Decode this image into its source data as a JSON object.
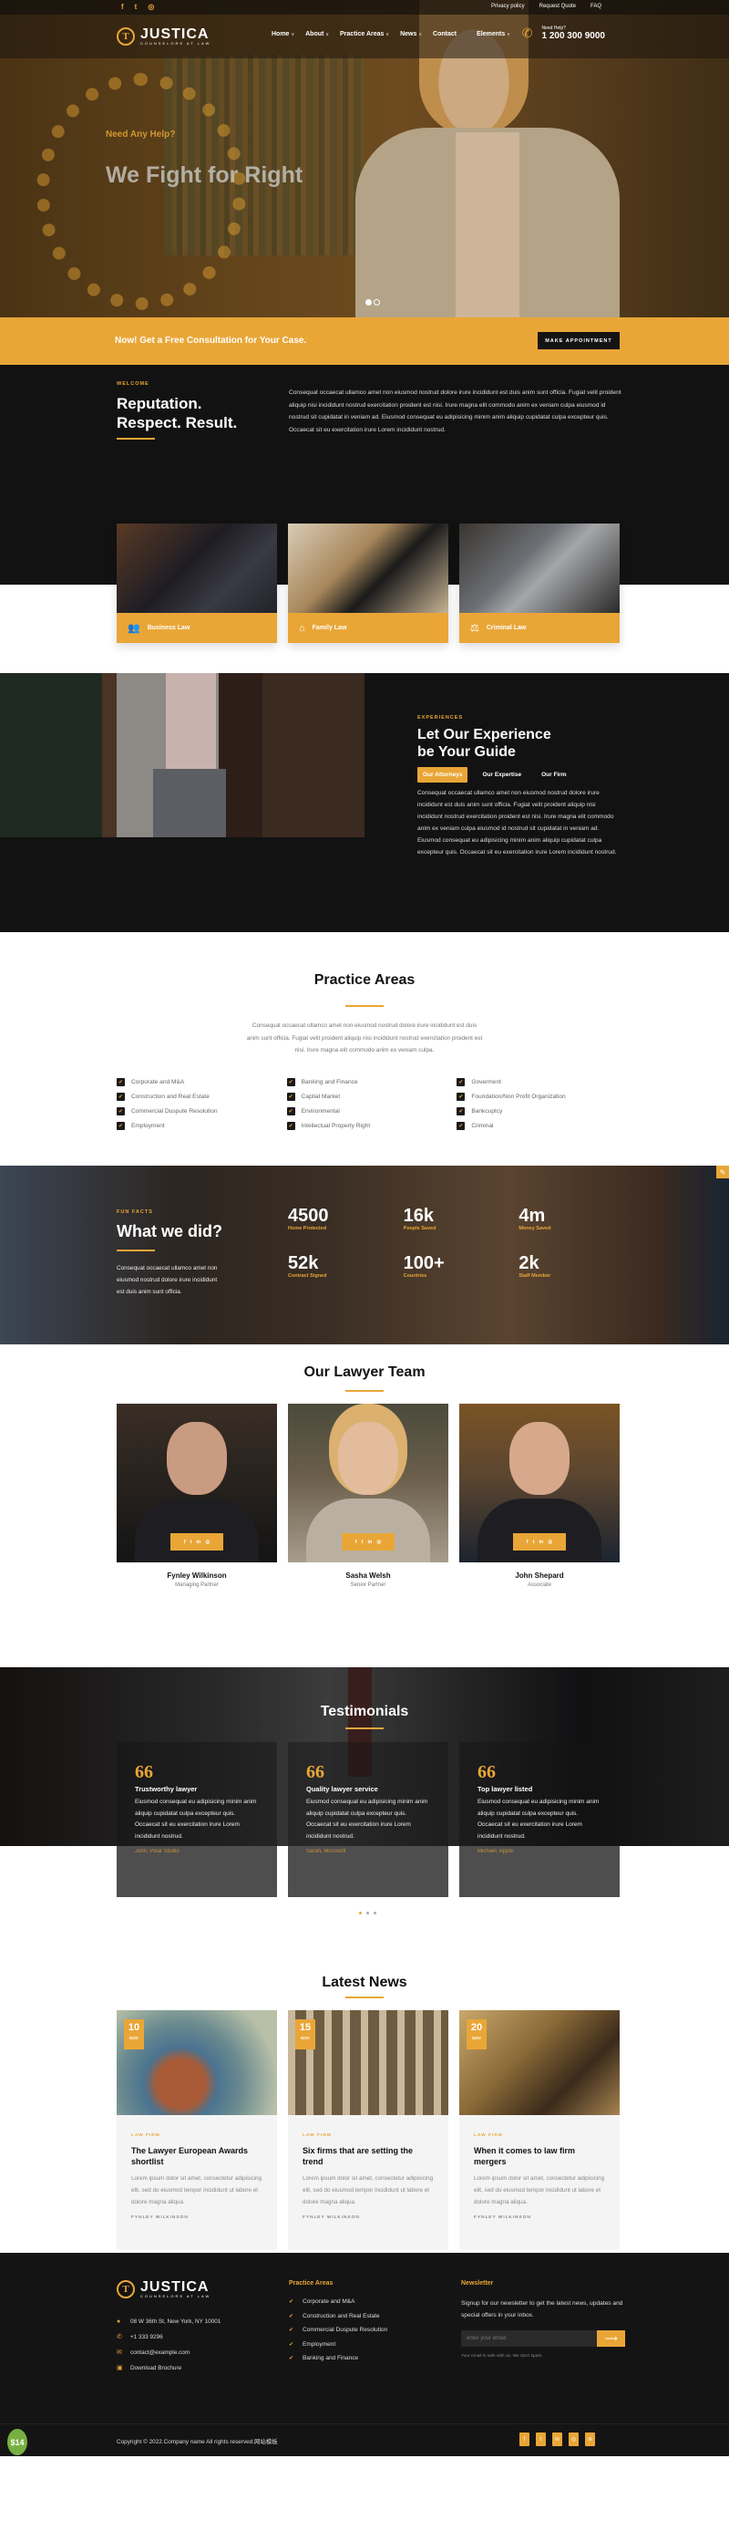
{
  "colors": {
    "accent": "#e9a637",
    "dark": "#121212",
    "light_gray": "#f4f4f4"
  },
  "topbar": {
    "social": [
      {
        "icon": "facebook-icon",
        "glyph": "f"
      },
      {
        "icon": "twitter-icon",
        "glyph": "t"
      },
      {
        "icon": "instagram-icon",
        "glyph": "◎"
      }
    ],
    "links": [
      "Privacy policy",
      "Request Quote",
      "FAQ"
    ]
  },
  "brand": {
    "name": "JUSTICA",
    "tagline": "COUNSELORS AT LAW",
    "mark": "T"
  },
  "nav": {
    "items": [
      {
        "label": "Home",
        "dropdown": true
      },
      {
        "label": "About",
        "dropdown": true
      },
      {
        "label": "Practice Areas",
        "dropdown": true
      },
      {
        "label": "News",
        "dropdown": true
      },
      {
        "label": "Contact",
        "dropdown": false
      },
      {
        "label": "Elements",
        "dropdown": true
      }
    ],
    "chevron": "∨",
    "help_label": "Need Help?",
    "help_phone": "1 200 300 9000"
  },
  "hero": {
    "kicker": "Need Any Help?",
    "title": "We Fight for Right",
    "slides": 2,
    "active_slide": 1
  },
  "cta": {
    "text": "Now! Get a Free Consultation for Your Case.",
    "button": "MAKE APPOINTMENT"
  },
  "welcome": {
    "kicker": "WELCOME",
    "title_line1": "Reputation.",
    "title_line2": "Respect. Result.",
    "text": "Consequat occaecat ullamco amet non eiusmod nostrud dolore irure incididunt est duis anim sunt officia. Fugiat velit proident aliquip nisi incididunt nostrud exercitation proident est nisi. Irure magna elit commodo anim ex veniam culpa eiusmod id nostrud sit cupidatat in veniam ad. Eiusmod consequat eu adipisicing minim anim aliquip cupidatat culpa excepteur quis. Occaecat sit eu exercitation irure Lorem incididunt nostrud."
  },
  "services": [
    {
      "label": "Business Law",
      "icon": "users-icon",
      "glyph": "👥"
    },
    {
      "label": "Family Law",
      "icon": "home-icon",
      "glyph": "⌂"
    },
    {
      "label": "Criminal Law",
      "icon": "gavel-icon",
      "glyph": "⚖"
    }
  ],
  "experience": {
    "kicker": "EXPERIENCES",
    "title_line1": "Let Our Experience",
    "title_line2": "be Your Guide",
    "tabs": [
      "Our Attorneys",
      "Our Expertise",
      "Our Firm"
    ],
    "active_tab": 0,
    "text": "Consequat occaecat ullamco amet non eiusmod nostrud dolore irure incididunt est duis anim sunt officia. Fugiat velit proident aliquip nisi incididunt nostrud exercitation proident est nisi. Irure magna elit commodo anim ex veniam culpa eiusmod id nostrud sit cupidatat in veniam ad. Eiusmod consequat eu adipisicing minim anim aliquip cupidatat culpa excepteur quis. Occaecat sit eu exercitation irure Lorem incididunt nostrud."
  },
  "practice": {
    "title": "Practice Areas",
    "text": "Consequat occaecat ullamco amet non eiusmod nostrud dolore irure incididunt est duis anim sunt officia. Fugiat velit proident aliquip nisi incididunt nostrud exercitation proident est nisi. Irure magna elit commodo anim ex veniam culpa.",
    "columns": [
      [
        "Corporate and M&A",
        "Construction and Real Estate",
        "Commercial Duspute Resolution",
        "Employment"
      ],
      [
        "Banking and Finance",
        "Captial Market",
        "Environmental",
        "Intellectual Property Right"
      ],
      [
        "Goverment",
        "Foundation/Non Profit Organization",
        "Bankcuptcy",
        "Criminal"
      ]
    ]
  },
  "facts": {
    "kicker": "FUN FACTS",
    "title": "What we did?",
    "text": "Consequat occaecat ullamco amet non eiusmod nostrud dolore irure incididunt est duis anim sunt officia.",
    "stats": [
      {
        "value": "4500",
        "label": "Home Protected"
      },
      {
        "value": "16k",
        "label": "People Saved"
      },
      {
        "value": "4m",
        "label": "Money Saved"
      },
      {
        "value": "52k",
        "label": "Contract Signed"
      },
      {
        "value": "100+",
        "label": "Countries"
      },
      {
        "value": "2k",
        "label": "Staff Member"
      }
    ]
  },
  "team": {
    "title": "Our Lawyer Team",
    "social": [
      "f",
      "t",
      "in",
      "◎"
    ],
    "members": [
      {
        "name": "Fynley Wilkinson",
        "role": "Managing Partner"
      },
      {
        "name": "Sasha Welsh",
        "role": "Senior Partner"
      },
      {
        "name": "John Shepard",
        "role": "Associate"
      }
    ]
  },
  "testimonials": {
    "title": "Testimonials",
    "quote_glyph": "66",
    "items": [
      {
        "title": "Trustworthy lawyer",
        "text": "Eiusmod consequat eu adipisicing minim anim aliquip cupidatat culpa excepteur quis. Occaecat sit eu exercitation irure Lorem incididunt nostrud.",
        "author": "John, Pixar Studio"
      },
      {
        "title": "Quality lawyer service",
        "text": "Eiusmod consequat eu adipisicing minim anim aliquip cupidatat culpa excepteur quis. Occaecat sit eu exercitation irure Lorem incididunt nostrud.",
        "author": "Sarah, Microsoft"
      },
      {
        "title": "Top lawyer listed",
        "text": "Eiusmod consequat eu adipisicing minim anim aliquip cupidatat culpa excepteur quis. Occaecat sit eu exercitation irure Lorem incididunt nostrud.",
        "author": "Michael, Apple"
      }
    ],
    "pages": 3,
    "active_page": 1
  },
  "news": {
    "title": "Latest News",
    "items": [
      {
        "day": "10",
        "month": "NOV",
        "category": "LAW FIRM",
        "title": "The Lawyer European Awards shortlist",
        "excerpt": "Lorem ipsum dolor sit amet, consectetur adipisicing elit, sed do eiusmod tempor incididunt ut labore et dolore magna aliqua.",
        "author": "FYNLEY WILKINSON"
      },
      {
        "day": "15",
        "month": "NOV",
        "category": "LAW FIRM",
        "title": "Six firms that are setting the trend",
        "excerpt": "Lorem ipsum dolor sit amet, consectetur adipisicing elit, sed do eiusmod tempor incididunt ut labore et dolore magna aliqua.",
        "author": "FYNLEY WILKINSON"
      },
      {
        "day": "20",
        "month": "NOV",
        "category": "LAW FIRM",
        "title": "When it comes to law firm mergers",
        "excerpt": "Lorem ipsum dolor sit amet, consectetur adipisicing elit, sed do eiusmod tempor incididunt ut labore et dolore magna aliqua.",
        "author": "FYNLEY WILKINSON"
      }
    ]
  },
  "footer": {
    "contact": [
      {
        "icon": "location-icon",
        "glyph": "●",
        "text": "08 W 36th St, New York, NY 10001"
      },
      {
        "icon": "phone-icon",
        "glyph": "✆",
        "text": "+1 333 9296"
      },
      {
        "icon": "mail-icon",
        "glyph": "✉",
        "text": "contact@example.com"
      },
      {
        "icon": "file-icon",
        "glyph": "▣",
        "text": "Download Brochure"
      }
    ],
    "practice_title": "Practice Areas",
    "practice_items": [
      "Corporate and M&A",
      "Construction and Real Estate",
      "Commercial Duspute Resolution",
      "Employment",
      "Banking and Finance"
    ],
    "newsletter_title": "Newsletter",
    "newsletter_text": "Signup for our newsletter to get the latest news, updates and special offers in your inbox.",
    "email_placeholder": "enter your email",
    "submit_glyph": "⟶",
    "note": "Your email is safe with us. We don't spam.",
    "copyright": "Copyright © 2022.Company name All rights reserved.网站模板",
    "social": [
      "f",
      "t",
      "in",
      "◎",
      "≋"
    ],
    "badge": "$14"
  },
  "icons": {
    "check": "✔",
    "edit": "✎",
    "phone": "✆"
  }
}
